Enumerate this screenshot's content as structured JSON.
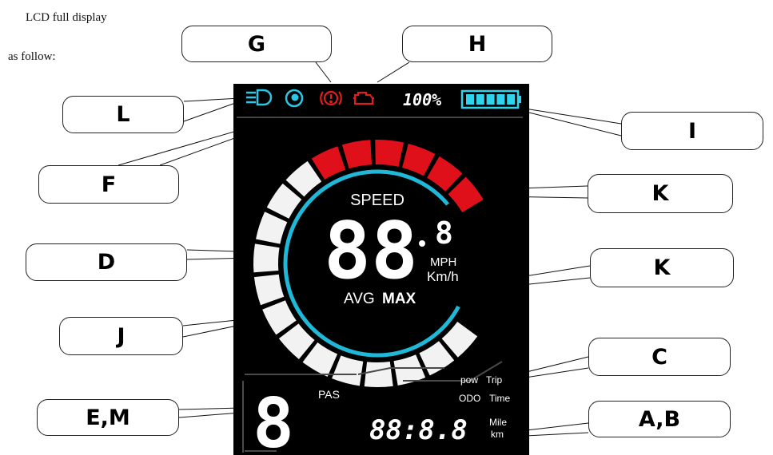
{
  "caption": {
    "line1": "LCD full display",
    "line2": "as follow:"
  },
  "callouts": {
    "G": "G",
    "H": "H",
    "L": "L",
    "F": "F",
    "I": "I",
    "K1": "K",
    "D": "D",
    "K2": "K",
    "J": "J",
    "C": "C",
    "EM": "E,M",
    "AB": "A,B"
  },
  "display": {
    "battery_percent_text": "100%",
    "battery_level": 1.0,
    "speed_label": "SPEED",
    "speed_digits": "88",
    "speed_decimal": "8",
    "unit_mph": "MPH",
    "unit_kmh": "Km/h",
    "avg_label": "AVG",
    "max_label": "MAX",
    "pas_label": "PAS",
    "pas_digit": "8",
    "pow_label": "pow",
    "trip_label": "Trip",
    "odo_label": "ODO",
    "time_label": "Time",
    "odometer_digits": "88:8.8",
    "mile_label": "Mile",
    "km_label": "km"
  },
  "colors": {
    "lcd_background": "#000000",
    "gauge_white": "#f2f2f2",
    "gauge_red": "#e0101a",
    "ring_cyan": "#1fb8d8",
    "battery_cyan": "#2ed4ee",
    "warning_red": "#e01e1e",
    "headlight_cyan": "#2ac8e8"
  },
  "icons": {
    "headlight": "headlight-icon",
    "assist": "walk-assist-icon",
    "brake_warning": "brake-warning-icon",
    "motor_fault": "motor-fault-icon",
    "battery": "battery-icon"
  }
}
